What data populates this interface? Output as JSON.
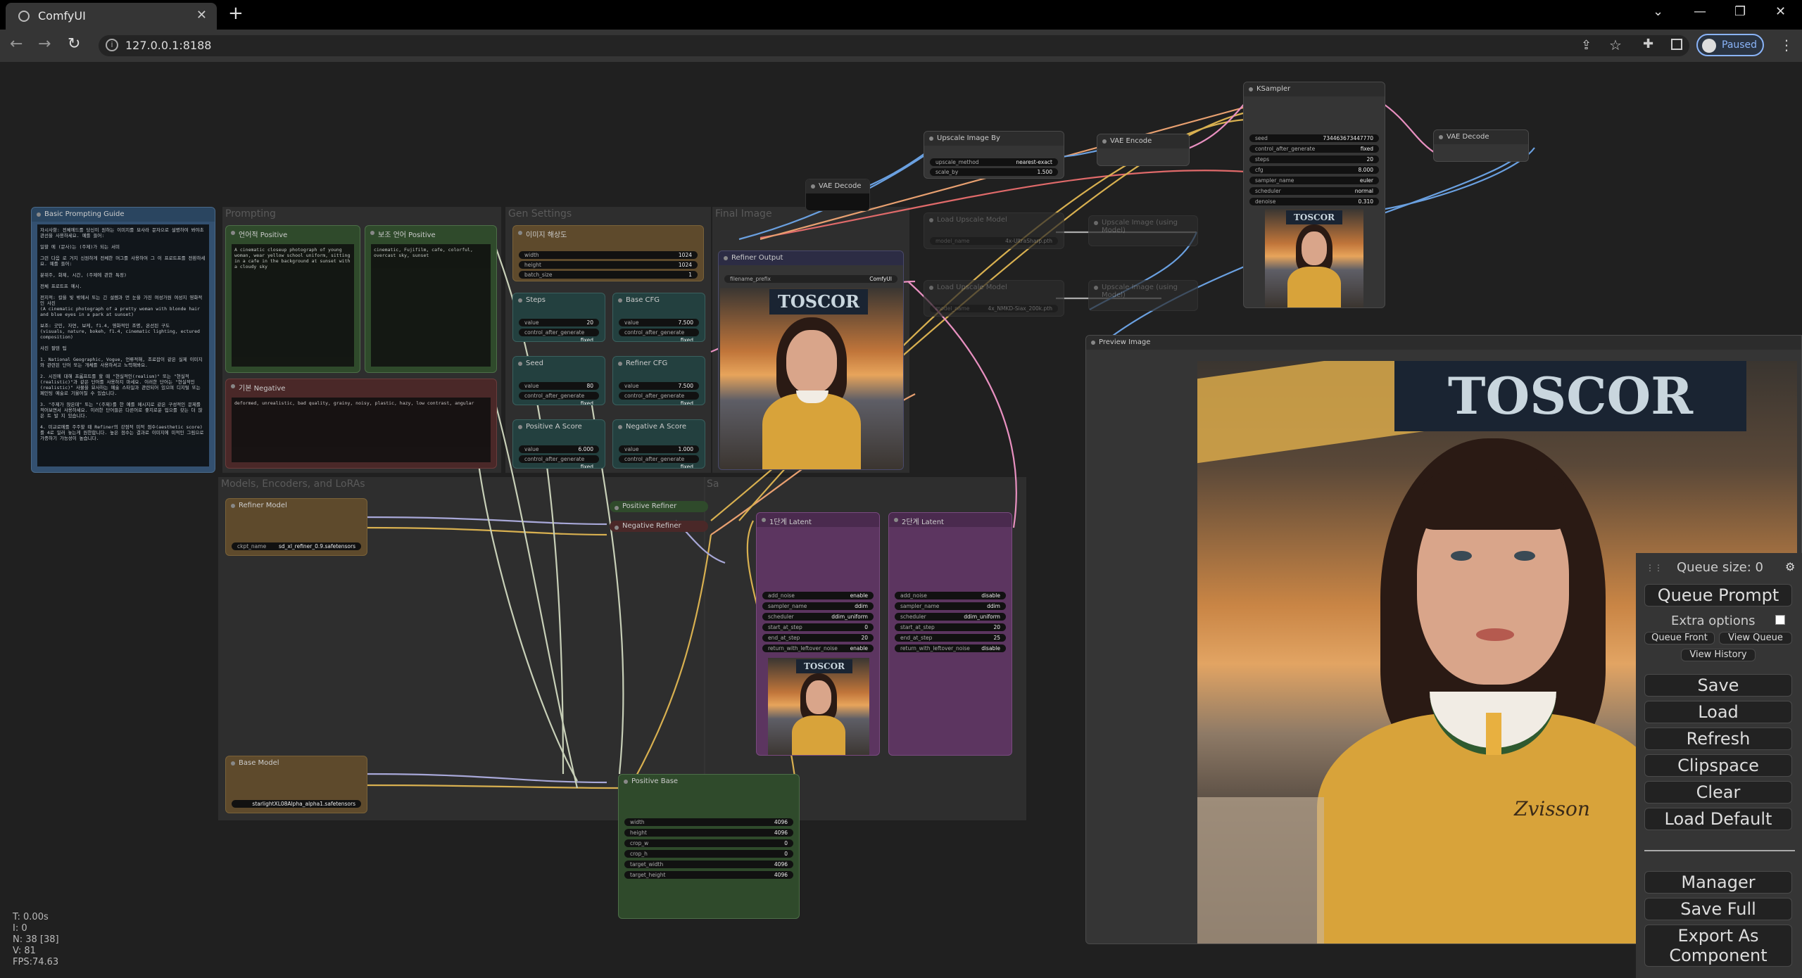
{
  "browser": {
    "tab_title": "ComfyUI",
    "tab_close": "✕",
    "new_tab": "+",
    "url": "127.0.0.1:8188",
    "profile_status": "Paused",
    "window_controls": [
      "⌄",
      "—",
      "❐",
      "✕"
    ]
  },
  "groups": {
    "prompting": "Prompting",
    "gen_settings": "Gen Settings",
    "final_image": "Final Image",
    "models": "Models, Encoders, and LoRAs",
    "sampling": "Sa"
  },
  "nodes": {
    "guide": {
      "title": "Basic Prompting Guide",
      "text": "자시사항: 전체에드를 당신이 원하는 이미지를 묘사라 문자으로 설명하여 봐야초관선을 사용하세요. 예를 들어:\n\n일할 에 (문사)는 (주제)가 되는 서미\n\n그런 다음 로 거지 신원하게 전체한 머그를 사용하여 그 이 프로트프를 전환하세요. 예를 들어:\n\n분위주, 화제, 시간, (주제에 관한 특정)\n\n전체 프로트프 예시.\n\n전지적: 칼을 빛 밖에서 또는 긴 설렘과 먼 눈을 가진 여성가원 여성지 영화적인 사진\n(A cinematic photograph of a pretty woman with blonde hair and blue eyes in a park at sunset)\n\n보조: 굿민, 자연, 보케, f1.4, 영화적인 조명, 온선된 구도\n(visuals, nature, bokeh, f1.4, cinematic lighting, ectured composition)\n\n사진 팔텐 팁\n\n1. National Geographic, Vogue, 언류적해, 조료잡이 같은 실제 이미지와 관련된 단어 또는 개체를 사용하셔고 노력해봐요.\n\n2. 시진에 대해 프롬프트를 할 때 \"현실적인(realism)\" 또는 \"현실적(realistic)\"과 같은 단어를 사용하지 마세요. 이러한 단어는 \"현실적인(realistic)\" 사물을 묘사하는 예술 스타일과 관련되어 있으며 디지털 또는 페인팅 예술로 기울어질 수 있습니다.\n\n3. \"주제가 앉은데\" 또는 \"(주제)를 한 예를 메시지로 같은 구성적인 문제를 적어보면서 사용하세요. 이러한 단어들은 다른어로 좋지로운 입으를 갖는 더 많은 트 발 지 있습니다.\n\n4. 미교로에를 주주할 때 Refiner의 강점적 미적 점수(aesthetic score)를 4로 일러 놓는게 원한합니다. 높은 점수는 결과로 이미지에 미적인 그림으로 가증하기 가능성이 높습니다."
    },
    "positive_ko": {
      "title": "언어적 Positive",
      "text": "A cinematic closeup photograph of young woman, wear yellow school uniform, sitting in a cafe in the background at sunset with a cloudy sky"
    },
    "positive_aux": {
      "title": "보조 언어 Positive",
      "text": "cinematic, Fujifilm, cafe, colorful, overcast sky, sunset"
    },
    "negative": {
      "title": "기본 Negative",
      "text": "deformed, unrealistic, bad quality, grainy, noisy, plastic, hazy, low contrast, angular"
    },
    "image_size": {
      "title": "이미지 해상도",
      "widgets": [
        {
          "label": "width",
          "value": "1024"
        },
        {
          "label": "height",
          "value": "1024"
        },
        {
          "label": "batch_size",
          "value": "1"
        }
      ]
    },
    "steps": {
      "title": "Steps",
      "widgets": [
        {
          "label": "value",
          "value": "20"
        },
        {
          "label": "control_after_generate",
          "value": "fixed"
        }
      ]
    },
    "base_cfg": {
      "title": "Base CFG",
      "widgets": [
        {
          "label": "value",
          "value": "7.500"
        },
        {
          "label": "control_after_generate",
          "value": "fixed"
        }
      ]
    },
    "seed": {
      "title": "Seed",
      "widgets": [
        {
          "label": "value",
          "value": "80"
        },
        {
          "label": "control_after_generate",
          "value": "fixed"
        }
      ]
    },
    "refiner_cfg": {
      "title": "Refiner CFG",
      "widgets": [
        {
          "label": "value",
          "value": "7.500"
        },
        {
          "label": "control_after_generate",
          "value": "fixed"
        }
      ]
    },
    "pos_a_score": {
      "title": "Positive A Score",
      "widgets": [
        {
          "label": "value",
          "value": "6.000"
        },
        {
          "label": "control_after_generate",
          "value": "fixed"
        }
      ]
    },
    "neg_a_score": {
      "title": "Negative A Score",
      "widgets": [
        {
          "label": "value",
          "value": "1.000"
        },
        {
          "label": "control_after_generate",
          "value": "fixed"
        }
      ]
    },
    "refiner_output": {
      "title": "Refiner Output",
      "widgets": [
        {
          "label": "filename_prefix",
          "value": "ComfyUI"
        }
      ]
    },
    "vae_decode_top": {
      "title": "VAE Decode"
    },
    "refiner_model": {
      "title": "Refiner Model",
      "widgets": [
        {
          "label": "ckpt_name",
          "value": "sd_xl_refiner_0.9.safetensors"
        }
      ]
    },
    "base_model": {
      "title": "Base Model",
      "widgets": [
        {
          "label": "",
          "value": "starlightXL08Alpha_alpha1.safetensors"
        }
      ]
    },
    "positive_refiner": {
      "title": "Positive Refiner"
    },
    "negative_refiner": {
      "title": "Negative Refiner"
    },
    "latent1": {
      "title": "1단계 Latent",
      "widgets": [
        {
          "label": "add_noise",
          "value": "enable"
        },
        {
          "label": "sampler_name",
          "value": "ddim"
        },
        {
          "label": "scheduler",
          "value": "ddim_uniform"
        },
        {
          "label": "start_at_step",
          "value": "0"
        },
        {
          "label": "end_at_step",
          "value": "20"
        },
        {
          "label": "return_with_leftover_noise",
          "value": "enable"
        }
      ]
    },
    "latent2": {
      "title": "2단계 Latent",
      "widgets": [
        {
          "label": "add_noise",
          "value": "disable"
        },
        {
          "label": "sampler_name",
          "value": "ddim"
        },
        {
          "label": "scheduler",
          "value": "ddim_uniform"
        },
        {
          "label": "start_at_step",
          "value": "20"
        },
        {
          "label": "end_at_step",
          "value": "25"
        },
        {
          "label": "return_with_leftover_noise",
          "value": "disable"
        }
      ]
    },
    "positive_base": {
      "title": "Positive Base",
      "widgets": [
        {
          "label": "width",
          "value": "4096"
        },
        {
          "label": "height",
          "value": "4096"
        },
        {
          "label": "crop_w",
          "value": "0"
        },
        {
          "label": "crop_h",
          "value": "0"
        },
        {
          "label": "target_width",
          "value": "4096"
        },
        {
          "label": "target_height",
          "value": "4096"
        }
      ]
    },
    "upscale_by": {
      "title": "Upscale Image By",
      "widgets": [
        {
          "label": "upscale_method",
          "value": "nearest-exact"
        },
        {
          "label": "scale_by",
          "value": "1.500"
        }
      ]
    },
    "vae_encode": {
      "title": "VAE Encode"
    },
    "load_upscale1": {
      "title": "Load Upscale Model",
      "widgets": [
        {
          "label": "model_name",
          "value": "4x-UltraSharp.pth"
        }
      ]
    },
    "load_upscale2": {
      "title": "Load Upscale Model",
      "widgets": [
        {
          "label": "model_name",
          "value": "4x_NMKD-Siax_200k.pth"
        }
      ]
    },
    "upscale_model1": {
      "title": "Upscale Image (using Model)"
    },
    "upscale_model2": {
      "title": "Upscale Image (using Model)"
    },
    "ksampler": {
      "title": "KSampler",
      "widgets": [
        {
          "label": "seed",
          "value": "734463673447770"
        },
        {
          "label": "control_after_generate",
          "value": "fixed"
        },
        {
          "label": "steps",
          "value": "20"
        },
        {
          "label": "cfg",
          "value": "8.000"
        },
        {
          "label": "sampler_name",
          "value": "euler"
        },
        {
          "label": "scheduler",
          "value": "normal"
        },
        {
          "label": "denoise",
          "value": "0.310"
        }
      ]
    },
    "vae_decode_right": {
      "title": "VAE Decode"
    },
    "preview": {
      "title": "Preview Image"
    }
  },
  "image_text": {
    "sign": "TOSCOR",
    "badge": "Zvisson"
  },
  "queue_panel": {
    "queue_size": "Queue size: 0",
    "queue_prompt": "Queue Prompt",
    "extra_options": "Extra options",
    "queue_front": "Queue Front",
    "view_queue": "View Queue",
    "view_history": "View History",
    "save": "Save",
    "load": "Load",
    "refresh": "Refresh",
    "clipspace": "Clipspace",
    "clear": "Clear",
    "load_default": "Load Default",
    "manager": "Manager",
    "save_full": "Save Full",
    "export_component": "Export As Component"
  },
  "stats": [
    "T: 0.00s",
    "I: 0",
    "N: 38 [38]",
    "V: 81",
    "FPS:74.63"
  ],
  "colors": {
    "green_node": "#2f4a2b",
    "red_node": "#4a2828",
    "brown_node": "#5e4a2c",
    "teal_node": "#23403f",
    "purple_node": "#5c3560",
    "dark_node": "#353535",
    "accent_blue": "#8ab4f8"
  }
}
